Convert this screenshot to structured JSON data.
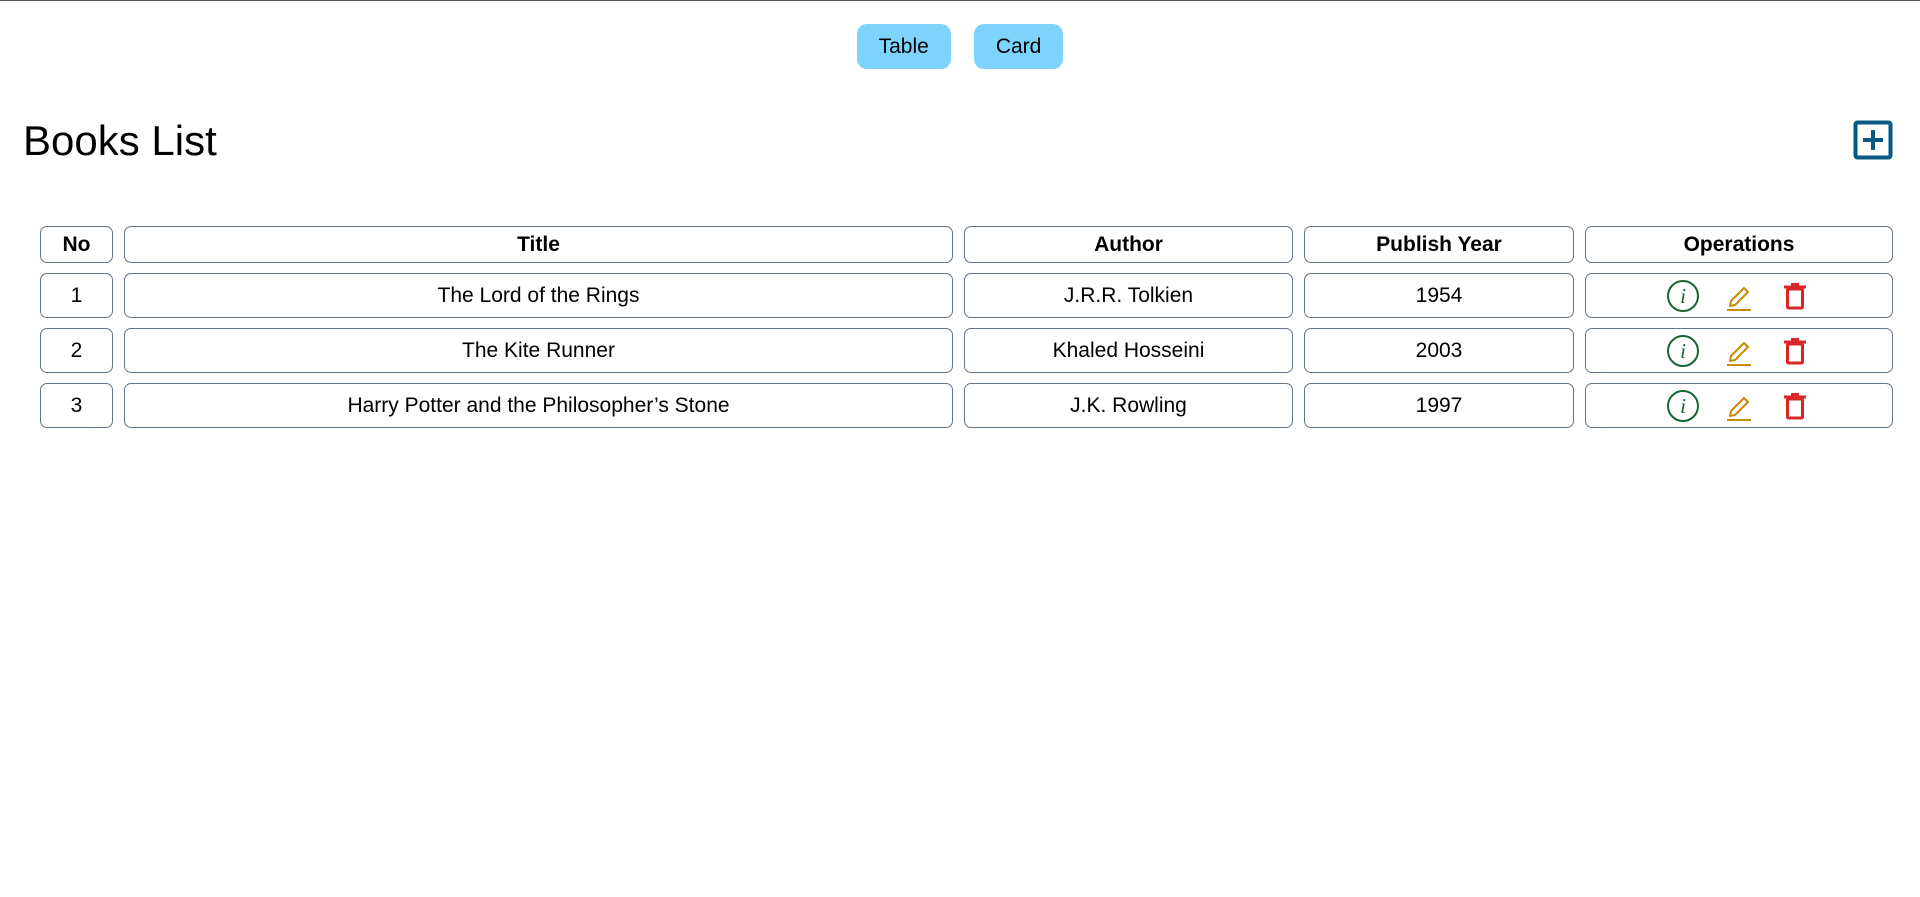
{
  "view_toggle": {
    "table_label": "Table",
    "card_label": "Card",
    "color": "#7dd3fc"
  },
  "header": {
    "title": "Books List",
    "add_icon": "plus-square-icon",
    "add_icon_color": "#075985"
  },
  "table": {
    "columns": [
      "No",
      "Title",
      "Author",
      "Publish Year",
      "Operations"
    ],
    "rows": [
      {
        "no": "1",
        "title": "The Lord of the Rings",
        "author": "J.R.R. Tolkien",
        "year": "1954"
      },
      {
        "no": "2",
        "title": "The Kite Runner",
        "author": "Khaled Hosseini",
        "year": "2003"
      },
      {
        "no": "3",
        "title": "Harry Potter and the Philosopher’s Stone",
        "author": "J.K. Rowling",
        "year": "1997"
      }
    ],
    "operations": [
      {
        "icon": "info-circle-icon",
        "color": "#166534"
      },
      {
        "icon": "edit-pencil-icon",
        "color": "#ca8a04"
      },
      {
        "icon": "trash-icon",
        "color": "#dc2626"
      }
    ]
  }
}
